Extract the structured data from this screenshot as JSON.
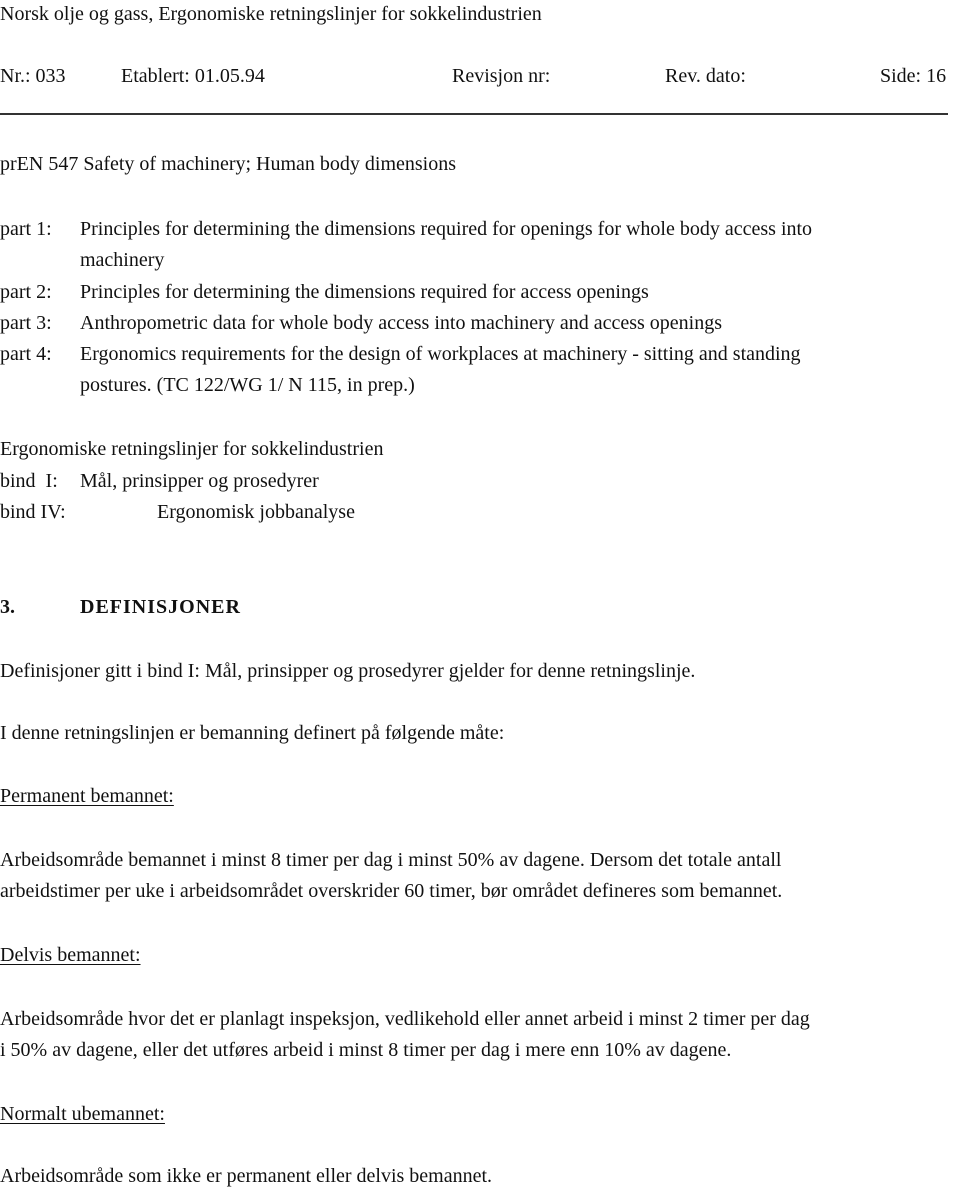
{
  "header": {
    "title": "Norsk olje og gass, Ergonomiske retningslinjer for sokkelindustrien",
    "nr": "Nr.: 033",
    "etablert": "Etablert: 01.05.94",
    "revisjon": "Revisjon nr:",
    "rev_dato": "Rev. dato:",
    "side": "Side: 16"
  },
  "standard": {
    "title": "prEN 547 Safety of machinery; Human body dimensions",
    "parts": [
      {
        "label": "part 1:",
        "lines": [
          "Principles for determining the dimensions required for openings for whole body access into",
          "machinery"
        ]
      },
      {
        "label": "part 2:",
        "lines": [
          "Principles for determining the dimensions required for access openings"
        ]
      },
      {
        "label": "part 3:",
        "lines": [
          "Anthropometric data for whole body access into machinery and access openings"
        ]
      },
      {
        "label": "part 4:",
        "lines": [
          "Ergonomics requirements for the design of workplaces at machinery - sitting and standing",
          "postures. (TC 122/WG 1/ N 115, in prep.)"
        ]
      }
    ]
  },
  "guidelines": {
    "title": "Ergonomiske retningslinjer for sokkelindustrien",
    "bind1_label": "bind  I:",
    "bind1_text": "Mål, prinsipper og prosedyrer",
    "bind4_label": "bind IV:",
    "bind4_text": "Ergonomisk jobbanalyse"
  },
  "section": {
    "number": "3.",
    "title": "DEFINISJONER",
    "intro1": "Definisjoner gitt i bind I: Mål, prinsipper og prosedyrer gjelder for denne retningslinje.",
    "intro2": "I denne retningslinjen er bemanning definert på følgende måte:",
    "definitions": [
      {
        "term": "Permanent bemannet:",
        "lines": [
          "Arbeidsområde bemannet i minst 8 timer per dag i minst 50% av dagene. Dersom det totale antall",
          "arbeidstimer per uke i arbeidsområdet overskrider 60 timer, bør området defineres som bemannet."
        ]
      },
      {
        "term": "Delvis bemannet:",
        "lines": [
          "Arbeidsområde hvor det er planlagt inspeksjon, vedlikehold eller annet arbeid i minst 2 timer per dag",
          "i 50% av dagene, eller det utføres arbeid i minst 8 timer per dag i mere enn 10% av dagene."
        ]
      },
      {
        "term": "Normalt ubemannet:",
        "lines": [
          "Arbeidsområde som ikke er permanent eller delvis bemannet."
        ]
      }
    ]
  }
}
